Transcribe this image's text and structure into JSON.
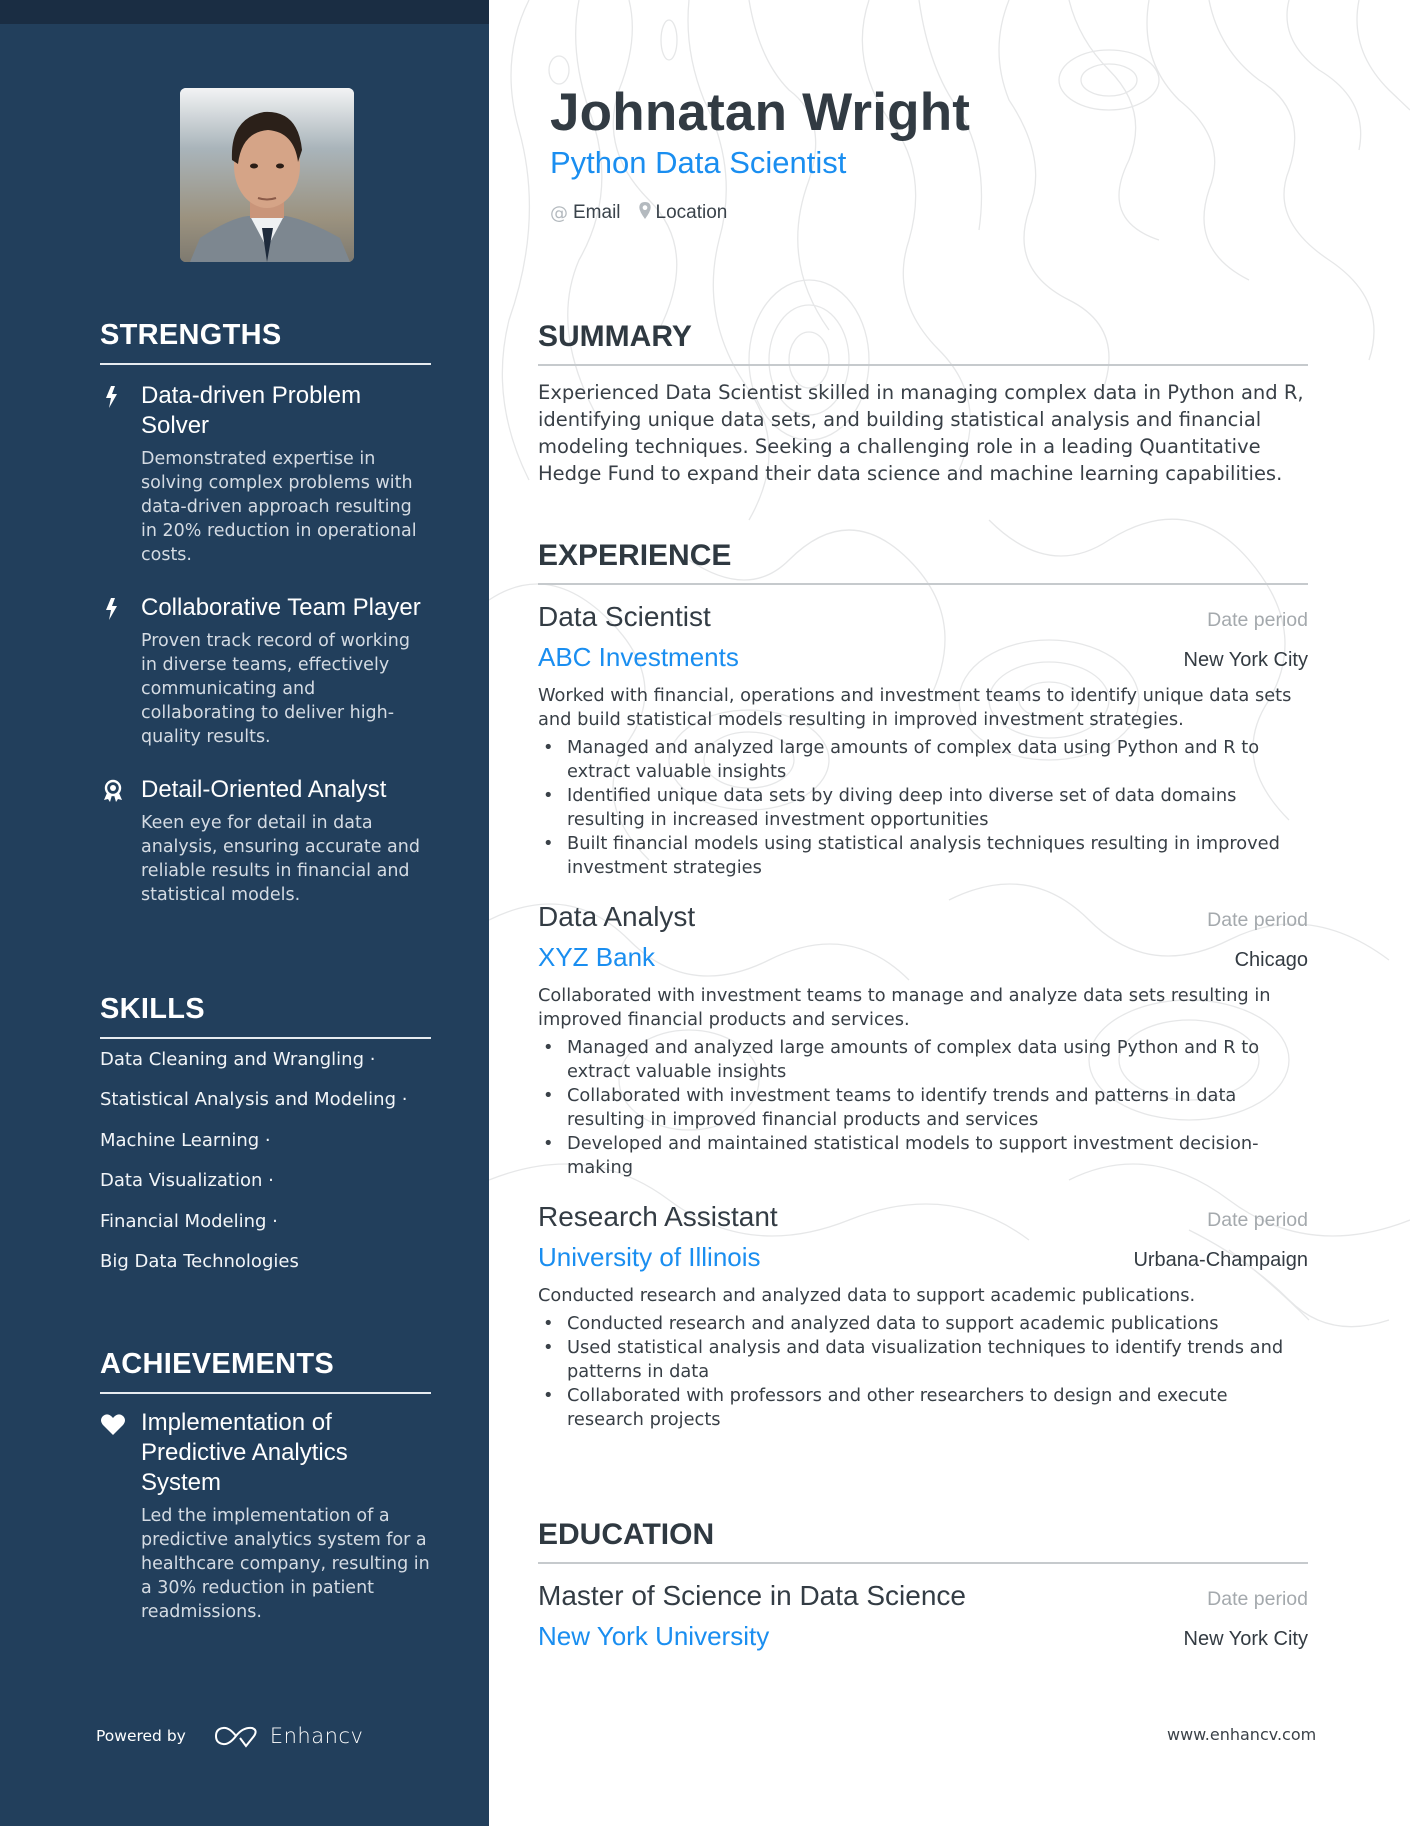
{
  "sidebar": {
    "strengths": {
      "heading": "STRENGTHS",
      "items": [
        {
          "icon": "bolt-icon",
          "title": "Data-driven Problem Solver",
          "description": "Demonstrated expertise in solving complex problems with data-driven approach resulting in 20% reduction in operational costs."
        },
        {
          "icon": "bolt-icon",
          "title": "Collaborative Team Player",
          "description": "Proven track record of working in diverse teams, effectively communicating and collaborating to deliver high-quality results."
        },
        {
          "icon": "award-ribbon-icon",
          "title": "Detail-Oriented Analyst",
          "description": "Keen eye for detail in data analysis, ensuring accurate and reliable results in financial and statistical models."
        }
      ]
    },
    "skills": {
      "heading": "SKILLS",
      "items": [
        "Data Cleaning and Wrangling ·",
        "Statistical Analysis and Modeling ·",
        "Machine Learning ·",
        "Data Visualization ·",
        "Financial Modeling ·",
        "Big Data Technologies"
      ]
    },
    "achievements": {
      "heading": "ACHIEVEMENTS",
      "items": [
        {
          "icon": "heart-icon",
          "title": "Implementation of Predictive Analytics System",
          "description": "Led the implementation of a predictive analytics system for a healthcare company, resulting in a 30% reduction in patient readmissions."
        }
      ]
    },
    "footer": {
      "powered_by": "Powered by",
      "brand": "Enhancv"
    }
  },
  "header": {
    "name": "Johnatan Wright",
    "role": "Python Data Scientist",
    "contacts": [
      {
        "icon": "at-icon",
        "label": "Email"
      },
      {
        "icon": "location-pin-icon",
        "label": "Location"
      }
    ]
  },
  "summary": {
    "heading": "SUMMARY",
    "text": "Experienced Data Scientist skilled in managing complex data in Python and R, identifying unique data sets, and building statistical analysis and financial modeling techniques. Seeking a challenging role in a leading Quantitative Hedge Fund to expand their data science and machine learning capabilities."
  },
  "experience": {
    "heading": "EXPERIENCE",
    "items": [
      {
        "title": "Data Scientist",
        "date": "Date period",
        "company": "ABC Investments",
        "location": "New York City",
        "description": "Worked with financial, operations and investment teams to identify unique data sets and build statistical models resulting in improved investment strategies.",
        "bullets": [
          "Managed and analyzed large amounts of complex data using Python and R to extract valuable insights",
          "Identified unique data sets by diving deep into diverse set of data domains resulting in increased investment opportunities",
          "Built financial models using statistical analysis techniques resulting in improved investment strategies"
        ]
      },
      {
        "title": "Data Analyst",
        "date": "Date period",
        "company": "XYZ Bank",
        "location": "Chicago",
        "description": "Collaborated with investment teams to manage and analyze data sets resulting in improved financial products and services.",
        "bullets": [
          "Managed and analyzed large amounts of complex data using Python and R to extract valuable insights",
          "Collaborated with investment teams to identify trends and patterns in data resulting in improved financial products and services",
          "Developed and maintained statistical models to support investment decision-making"
        ]
      },
      {
        "title": "Research Assistant",
        "date": "Date period",
        "company": "University of Illinois",
        "location": "Urbana-Champaign",
        "description": "Conducted research and analyzed data to support academic publications.",
        "bullets": [
          "Conducted research and analyzed data to support academic publications",
          "Used statistical analysis and data visualization techniques to identify trends and patterns in data",
          "Collaborated with professors and other researchers to design and execute research projects"
        ]
      }
    ]
  },
  "education": {
    "heading": "EDUCATION",
    "items": [
      {
        "degree": "Master of Science in Data Science",
        "date": "Date period",
        "school": "New York University",
        "location": "New York City"
      }
    ]
  },
  "footer": {
    "website": "www.enhancv.com"
  },
  "colors": {
    "sidebar": "#223f5c",
    "sidebar_topbar": "#1a2d43",
    "accent": "#1a8ef0",
    "text": "#383f46",
    "muted": "#a4a9ad"
  }
}
